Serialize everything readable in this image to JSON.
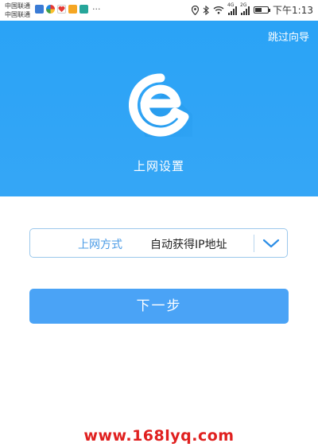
{
  "status_bar": {
    "carrier_1": "中国联通",
    "carrier_2": "中国联通",
    "more": "···",
    "network_label_1": "4G",
    "network_label_2": "2G",
    "time": "下午1:13",
    "battery_level": 0.55
  },
  "header": {
    "skip_label": "跳过向导",
    "title": "上网设置",
    "colors": {
      "background": "#2aa3f6",
      "logo": "#ffffff"
    }
  },
  "form": {
    "mode_label": "上网方式",
    "mode_value": "自动获得IP地址",
    "next_label": "下一步",
    "colors": {
      "accent": "#4aa3f6",
      "border": "#9cc8ec"
    }
  },
  "watermark": {
    "text": "www.168lyq.com",
    "color": "#e0201f"
  }
}
